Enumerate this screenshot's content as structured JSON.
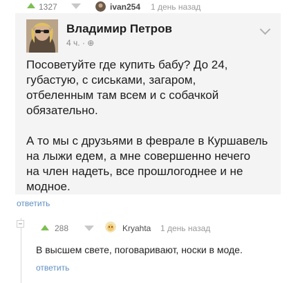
{
  "comment": {
    "score": "1327",
    "username": "ivan254",
    "time": "1 день назад",
    "reply_label": "ответить",
    "screenshot": {
      "author": "Владимир Петров",
      "meta": "4 ч. · ⊕",
      "text": "Посоветуйте где купить бабу? До 24,\nгубастую, с сиськами, загаром,\nотбеленным там всем и с собачкой\nобязательно.\n\nА то мы с друзьями в феврале в Куршавель\nна лыжи едем, а мне совершенно нечего\nна член надеть, все прошлогоднее и не\nмодное."
    }
  },
  "reply": {
    "score": "288",
    "username": "Kryahta",
    "time": "1 день назад",
    "text": "В высшем свете, поговаривают, носки в моде.",
    "reply_label": "ответить"
  },
  "colors": {
    "upvote": "#7cbf52",
    "link": "#5f8fc2",
    "muted": "#9a9a9a"
  }
}
